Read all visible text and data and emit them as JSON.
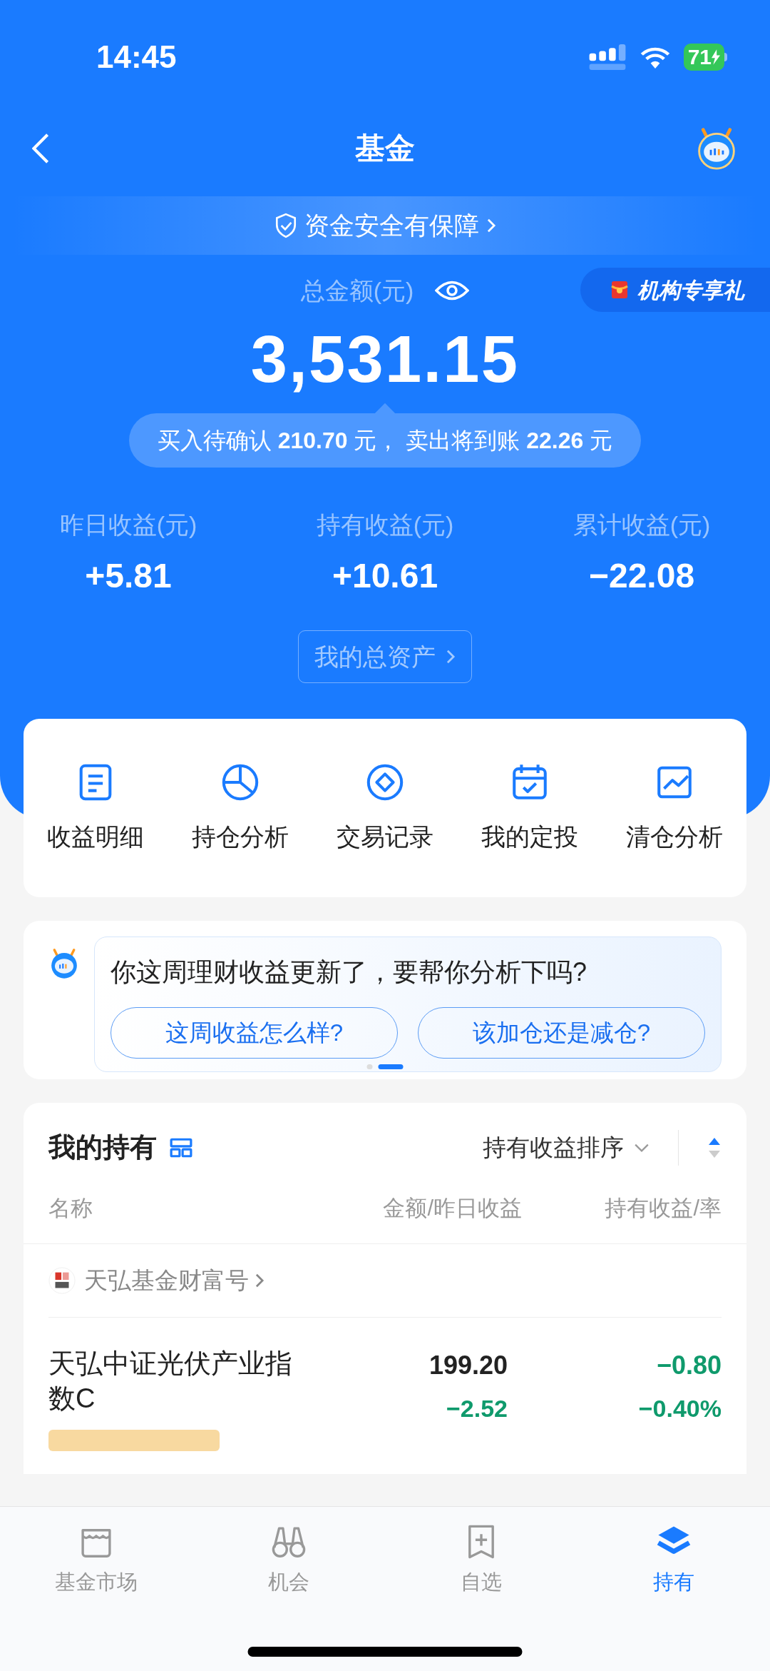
{
  "status_bar": {
    "time": "14:45",
    "battery": "71"
  },
  "nav": {
    "title": "基金",
    "security_banner": "资金安全有保障"
  },
  "summary": {
    "total_label": "总金额(元)",
    "promo_badge": "机构专享礼",
    "total_amount": "3,531.15",
    "pending": "买入待确认 **210.70** 元， 卖出将到账 **22.26** 元",
    "stats": [
      {
        "label": "昨日收益(元)",
        "value": "+5.81"
      },
      {
        "label": "持有收益(元)",
        "value": "+10.61"
      },
      {
        "label": "累计收益(元)",
        "value": "−22.08"
      }
    ],
    "assets_button": "我的总资产"
  },
  "shortcuts": [
    "收益明细",
    "持仓分析",
    "交易记录",
    "我的定投",
    "清仓分析"
  ],
  "assistant": {
    "message": "你这周理财收益更新了，要帮你分析下吗?",
    "suggestions": [
      "这周收益怎么样?",
      "该加仓还是减仓?"
    ],
    "pager": [
      {
        "selected": false
      },
      {
        "selected": true
      }
    ]
  },
  "holdings": {
    "title": "我的持有",
    "sort_label": "持有收益排序",
    "columns": [
      "名称",
      "金额/昨日收益",
      "持有收益/率"
    ],
    "groups": [
      {
        "company": "天弘基金财富号",
        "funds": [
          {
            "name": "天弘中证光伏产业指数C",
            "amount": "199.20",
            "yesterday": {
              "text": "−2.52",
              "color": "#0f9a6c"
            },
            "profit": {
              "text": "−0.80",
              "color": "#0f9a6c"
            },
            "rate": {
              "text": "−0.40%",
              "color": "#0f9a6c"
            }
          }
        ]
      }
    ]
  },
  "tab_bar": [
    {
      "label": "基金市场",
      "selected": false
    },
    {
      "label": "机会",
      "selected": false
    },
    {
      "label": "自选",
      "selected": false
    },
    {
      "label": "持有",
      "selected": true
    }
  ]
}
